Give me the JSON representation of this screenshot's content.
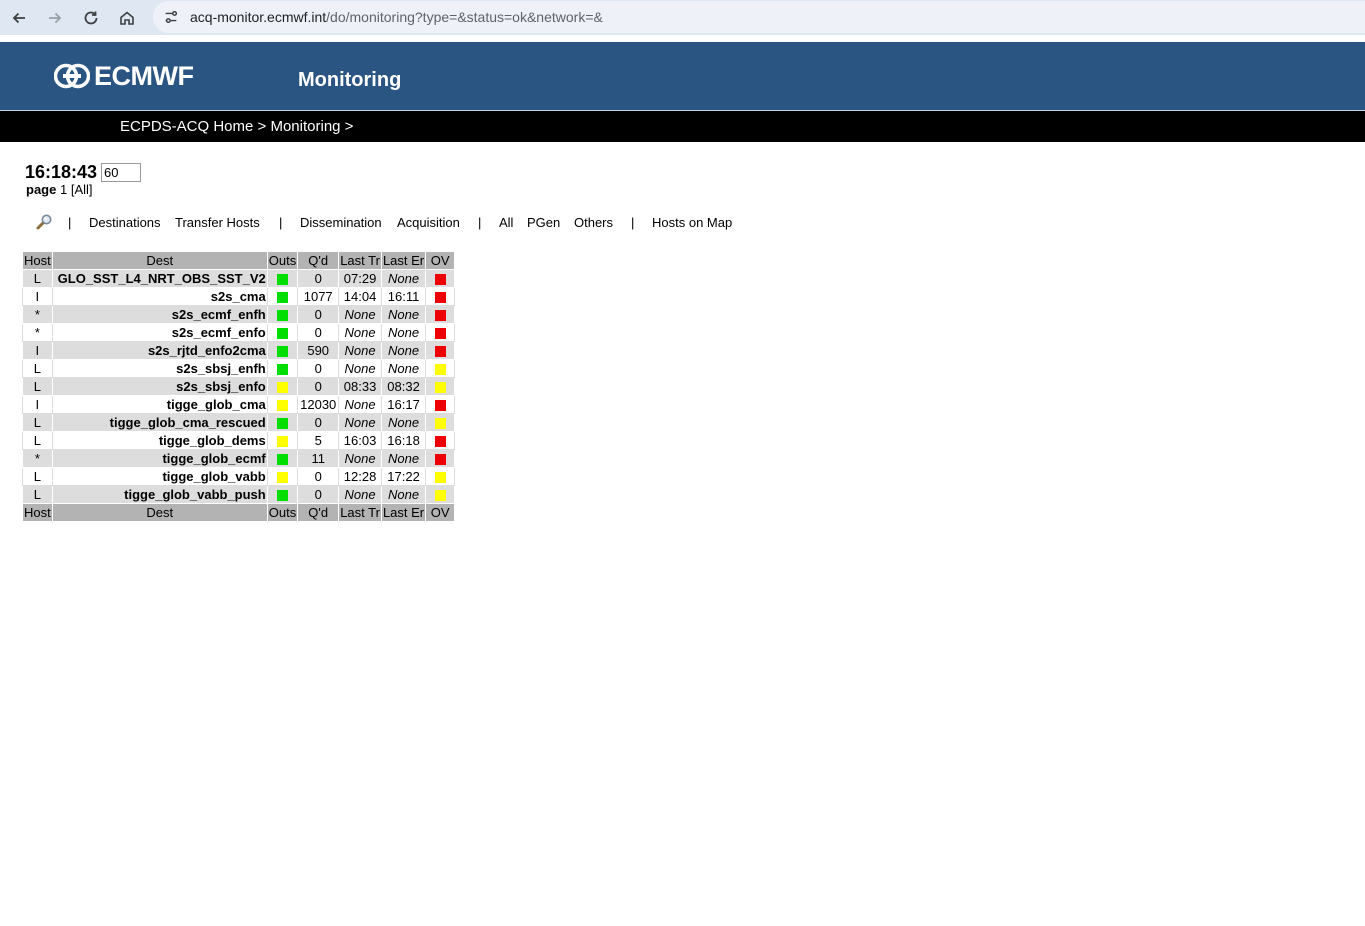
{
  "browser": {
    "url_host": "acq-monitor.ecmwf.int",
    "url_path": "/do/monitoring?type=&status=ok&network=&"
  },
  "colors": {
    "header_blue": "#2a5582",
    "status_green": "#00dd00",
    "status_yellow": "#ffff00",
    "status_red": "#ee0000"
  },
  "header": {
    "logo_text": "ECMWF",
    "title": "Monitoring"
  },
  "breadcrumb": {
    "home": "ECPDS-ACQ Home",
    "sep1": " > ",
    "current": "Monitoring",
    "sep2": " >"
  },
  "clock": {
    "time": "16:18:43",
    "refresh_value": "60"
  },
  "paging": {
    "label": "page",
    "current": "1",
    "all": "[All]"
  },
  "toolbar": {
    "search_icon": "search-icon",
    "sep": "|",
    "destinations": "Destinations",
    "transfer_hosts": "Transfer Hosts",
    "dissemination": "Dissemination",
    "acquisition": "Acquisition",
    "all": "All",
    "pgen": "PGen",
    "others": "Others",
    "hosts_on_map": "Hosts on Map"
  },
  "table": {
    "columns": [
      "Host",
      "Dest",
      "Outs",
      "Q'd",
      "Last Tr",
      "Last Er",
      "OV"
    ],
    "rows": [
      {
        "host": "L",
        "dest": "GLO_SST_L4_NRT_OBS_SST_V2",
        "outs": "green",
        "qd": "0",
        "last_tr": "07:29",
        "last_er": "None",
        "ov": "red"
      },
      {
        "host": "I",
        "dest": "s2s_cma",
        "outs": "green",
        "qd": "1077",
        "last_tr": "14:04",
        "last_er": "16:11",
        "ov": "red"
      },
      {
        "host": "*",
        "dest": "s2s_ecmf_enfh",
        "outs": "green",
        "qd": "0",
        "last_tr": "None",
        "last_er": "None",
        "ov": "red"
      },
      {
        "host": "*",
        "dest": "s2s_ecmf_enfo",
        "outs": "green",
        "qd": "0",
        "last_tr": "None",
        "last_er": "None",
        "ov": "red"
      },
      {
        "host": "I",
        "dest": "s2s_rjtd_enfo2cma",
        "outs": "green",
        "qd": "590",
        "last_tr": "None",
        "last_er": "None",
        "ov": "red"
      },
      {
        "host": "L",
        "dest": "s2s_sbsj_enfh",
        "outs": "green",
        "qd": "0",
        "last_tr": "None",
        "last_er": "None",
        "ov": "yellow"
      },
      {
        "host": "L",
        "dest": "s2s_sbsj_enfo",
        "outs": "yellow",
        "qd": "0",
        "last_tr": "08:33",
        "last_er": "08:32",
        "ov": "yellow"
      },
      {
        "host": "I",
        "dest": "tigge_glob_cma",
        "outs": "yellow",
        "qd": "12030",
        "last_tr": "None",
        "last_er": "16:17",
        "ov": "red"
      },
      {
        "host": "L",
        "dest": "tigge_glob_cma_rescued",
        "outs": "green",
        "qd": "0",
        "last_tr": "None",
        "last_er": "None",
        "ov": "yellow"
      },
      {
        "host": "L",
        "dest": "tigge_glob_dems",
        "outs": "yellow",
        "qd": "5",
        "last_tr": "16:03",
        "last_er": "16:18",
        "ov": "red"
      },
      {
        "host": "*",
        "dest": "tigge_glob_ecmf",
        "outs": "green",
        "qd": "11",
        "last_tr": "None",
        "last_er": "None",
        "ov": "red"
      },
      {
        "host": "L",
        "dest": "tigge_glob_vabb",
        "outs": "yellow",
        "qd": "0",
        "last_tr": "12:28",
        "last_er": "17:22",
        "ov": "yellow"
      },
      {
        "host": "L",
        "dest": "tigge_glob_vabb_push",
        "outs": "green",
        "qd": "0",
        "last_tr": "None",
        "last_er": "None",
        "ov": "yellow"
      }
    ]
  }
}
